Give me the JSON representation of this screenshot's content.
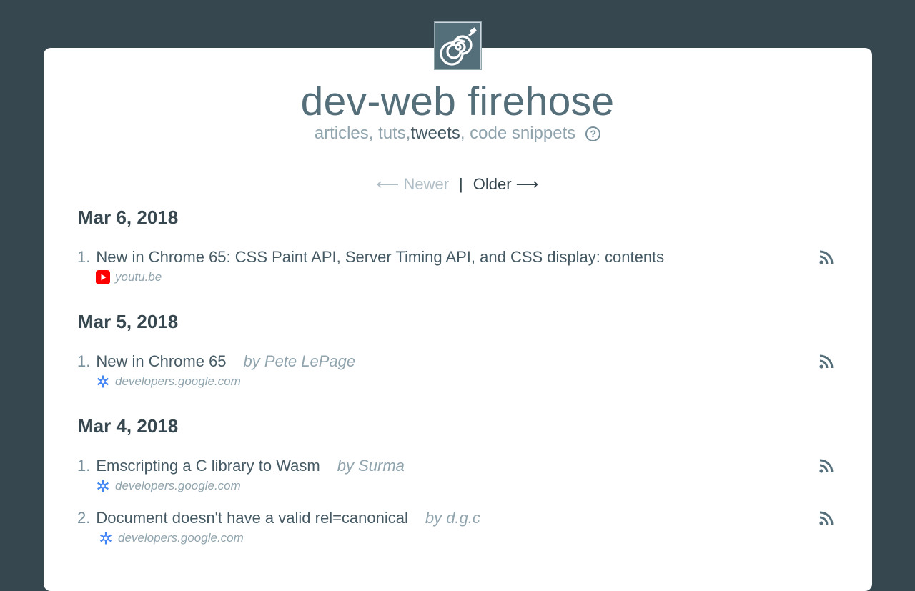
{
  "header": {
    "logo_icon": "hose-spiral-icon",
    "title": "dev-web firehose",
    "subtitle_part1": "articles, tuts, ",
    "subtitle_strong": "tweets",
    "subtitle_part2": ", code snippets",
    "help_glyph": "?"
  },
  "pager": {
    "newer_label": "⟵ Newer",
    "separator": "|",
    "older_label": "Older ⟶"
  },
  "days": [
    {
      "date": "Mar 6, 2018",
      "items": [
        {
          "num": "1.",
          "title": "New in Chrome 65: CSS Paint API, Server Timing API, and CSS display: contents",
          "author": "",
          "source": "youtu.be",
          "source_icon": "youtube-icon"
        }
      ]
    },
    {
      "date": "Mar 5, 2018",
      "items": [
        {
          "num": "1.",
          "title": "New in Chrome 65",
          "author": "by Pete LePage",
          "source": "developers.google.com",
          "source_icon": "google-developers-icon"
        }
      ]
    },
    {
      "date": "Mar 4, 2018",
      "items": [
        {
          "num": "1.",
          "title": "Emscripting a C library to Wasm",
          "author": "by Surma",
          "source": "developers.google.com",
          "source_icon": "google-developers-icon"
        },
        {
          "num": "2.",
          "title": "Document doesn't have a valid rel=canonical",
          "author": "by d.g.c",
          "source": "developers.google.com",
          "source_icon": "google-developers-icon"
        }
      ]
    }
  ],
  "colors": {
    "background": "#37474f",
    "card": "#ffffff",
    "youtube_red": "#ff0000",
    "google_blue": "#4285f4"
  }
}
